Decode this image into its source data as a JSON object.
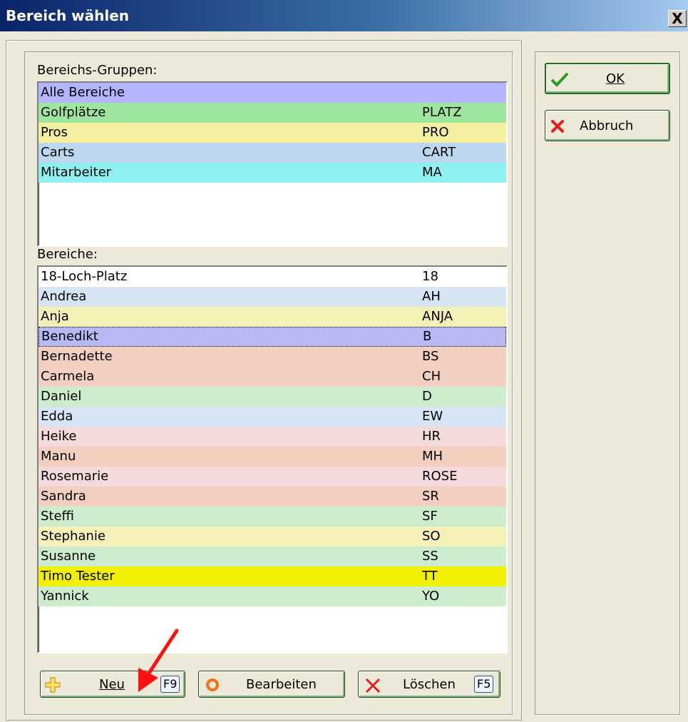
{
  "window": {
    "title": "Bereich wählen",
    "close_glyph": "X"
  },
  "groups": {
    "label": "Bereichs-Gruppen:",
    "items": [
      {
        "name": "Alle Bereiche",
        "code": "",
        "color": "#b4b4ff"
      },
      {
        "name": "Golfplätze",
        "code": "PLATZ",
        "color": "#9ee69e"
      },
      {
        "name": "Pros",
        "code": "PRO",
        "color": "#f5f0a0"
      },
      {
        "name": "Carts",
        "code": "CART",
        "color": "#bcd7ee"
      },
      {
        "name": "Mitarbeiter",
        "code": "MA",
        "color": "#8ef0f0"
      }
    ]
  },
  "areas": {
    "label": "Bereiche:",
    "items": [
      {
        "name": "18-Loch-Platz",
        "code": "18",
        "color": "#ffffff"
      },
      {
        "name": "Andrea",
        "code": "AH",
        "color": "#d6e4f4"
      },
      {
        "name": "Anja",
        "code": "ANJA",
        "color": "#f5f0b8"
      },
      {
        "name": "Benedikt",
        "code": "B",
        "color": "#b8b8f4"
      },
      {
        "name": "Bernadette",
        "code": "BS",
        "color": "#f2cfc0"
      },
      {
        "name": "Carmela",
        "code": "CH",
        "color": "#f2cfc0"
      },
      {
        "name": "Daniel",
        "code": "D",
        "color": "#cdeccd"
      },
      {
        "name": "Edda",
        "code": "EW",
        "color": "#d6e4f4"
      },
      {
        "name": "Heike",
        "code": "HR",
        "color": "#f4dada"
      },
      {
        "name": "Manu",
        "code": "MH",
        "color": "#f2cfc0"
      },
      {
        "name": "Rosemarie",
        "code": "ROSE",
        "color": "#f4dada"
      },
      {
        "name": "Sandra",
        "code": "SR",
        "color": "#f2cfc0"
      },
      {
        "name": "Steffi",
        "code": "SF",
        "color": "#cdeccd"
      },
      {
        "name": "Stephanie",
        "code": "SO",
        "color": "#f5f0b8"
      },
      {
        "name": "Susanne",
        "code": "SS",
        "color": "#cdeccd"
      },
      {
        "name": "Timo Tester",
        "code": "TT",
        "color": "#f0f000"
      },
      {
        "name": "Yannick",
        "code": "YO",
        "color": "#cdeccd"
      }
    ],
    "focused_index": 3
  },
  "buttons": {
    "ok": {
      "label": "OK",
      "icon": "check-icon"
    },
    "cancel": {
      "label": "Abbruch",
      "icon": "red-x-icon"
    },
    "new": {
      "label": "Neu",
      "key": "F9",
      "icon": "plus-icon"
    },
    "edit": {
      "label": "Bearbeiten",
      "icon": "ring-icon"
    },
    "delete": {
      "label": "Löschen",
      "key": "F5",
      "icon": "cross-icon"
    }
  },
  "annotation": {
    "type": "red-arrow",
    "target": "new-button"
  }
}
